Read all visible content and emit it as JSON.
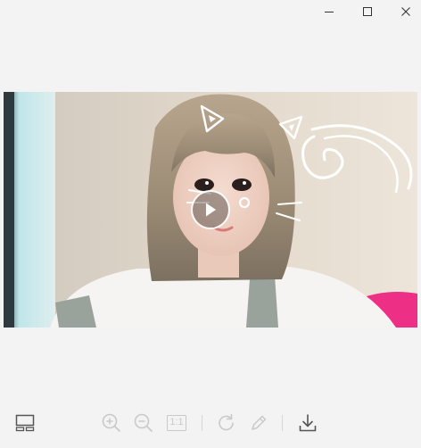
{
  "window": {
    "controls": [
      {
        "name": "minimize-button",
        "icon": "minimize-icon"
      },
      {
        "name": "maximize-button",
        "icon": "maximize-icon"
      },
      {
        "name": "close-button",
        "icon": "close-icon"
      }
    ]
  },
  "viewer": {
    "media_type": "video",
    "play_icon": "play-icon",
    "filters": {
      "face_filter": "cat-ears-and-whiskers"
    }
  },
  "toolbar": {
    "thumbnail_icon": "thumbnail-strip-icon",
    "zoom_in_icon": "zoom-in-icon",
    "zoom_out_icon": "zoom-out-icon",
    "actual_size_label": "1:1",
    "rotate_icon": "rotate-icon",
    "edit_icon": "edit-pencil-icon",
    "download_icon": "download-icon",
    "disabled_color": "#c9c9c9",
    "enabled_color": "#555555"
  },
  "colors": {
    "background": "#f3f3f3"
  }
}
